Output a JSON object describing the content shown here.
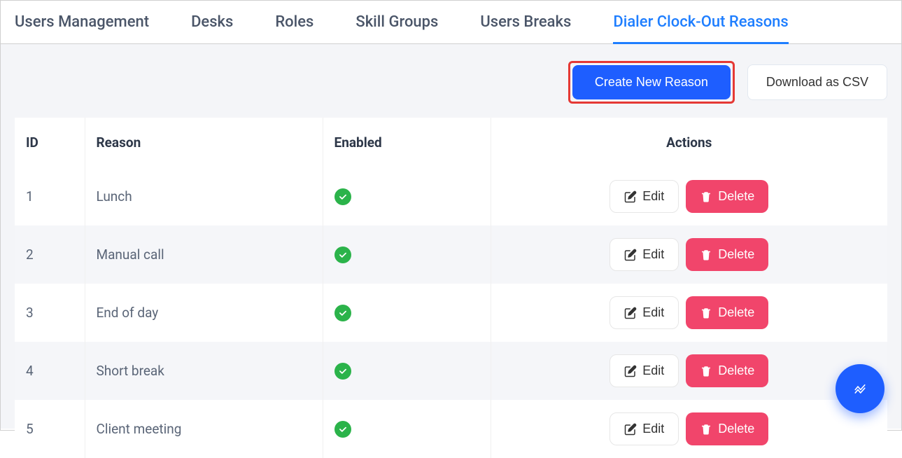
{
  "tabs": [
    {
      "label": "Users Management",
      "active": false
    },
    {
      "label": "Desks",
      "active": false
    },
    {
      "label": "Roles",
      "active": false
    },
    {
      "label": "Skill Groups",
      "active": false
    },
    {
      "label": "Users Breaks",
      "active": false
    },
    {
      "label": "Dialer Clock-Out Reasons",
      "active": true
    }
  ],
  "buttons": {
    "create": "Create New Reason",
    "download": "Download as CSV",
    "edit": "Edit",
    "delete": "Delete"
  },
  "columns": {
    "id": "ID",
    "reason": "Reason",
    "enabled": "Enabled",
    "actions": "Actions"
  },
  "rows": [
    {
      "id": "1",
      "reason": "Lunch",
      "enabled": true
    },
    {
      "id": "2",
      "reason": "Manual call",
      "enabled": true
    },
    {
      "id": "3",
      "reason": "End of day",
      "enabled": true
    },
    {
      "id": "4",
      "reason": "Short break",
      "enabled": true
    },
    {
      "id": "5",
      "reason": "Client meeting",
      "enabled": true
    }
  ]
}
